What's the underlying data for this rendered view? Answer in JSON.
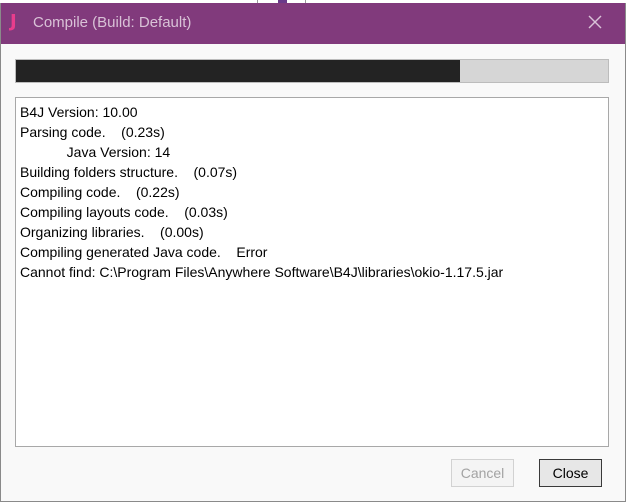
{
  "window": {
    "title": "Compile (Build: Default)",
    "app_icon_glyph": "J",
    "titlebar_color": "#813a7c",
    "app_icon_color": "#e83d8c"
  },
  "progress": {
    "value_fraction": 0.75,
    "fill_color": "#232323",
    "track_color": "#d6d6d6"
  },
  "log": {
    "lines": [
      "B4J Version: 10.00",
      "Parsing code.    (0.23s)",
      "            Java Version: 14",
      "Building folders structure.    (0.07s)",
      "Compiling code.    (0.22s)",
      "Compiling layouts code.    (0.03s)",
      "Organizing libraries.    (0.00s)",
      "Compiling generated Java code.    Error",
      "Cannot find: C:\\Program Files\\Anywhere Software\\B4J\\libraries\\okio-1.17.5.jar"
    ]
  },
  "buttons": {
    "cancel_label": "Cancel",
    "close_label": "Close"
  },
  "icons": {
    "close": "close-icon",
    "app": "b4j-app-icon"
  }
}
